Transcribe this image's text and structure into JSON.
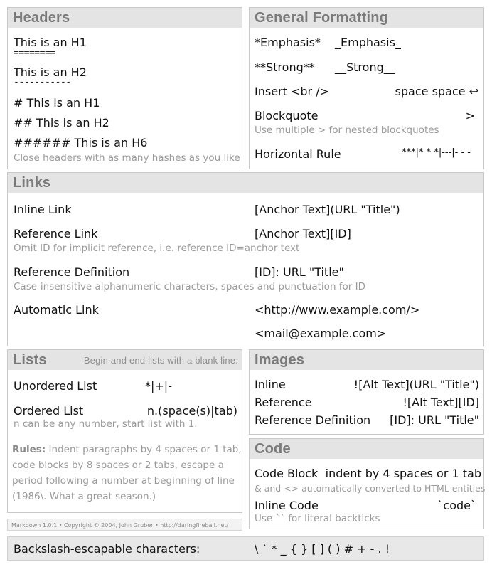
{
  "headers": {
    "title": "Headers",
    "h1_setext": "This is an H1",
    "h1_underline": "========",
    "h2_setext": "This is an H2",
    "h2_underline": "-----------",
    "atx_h1": "# This is an H1",
    "atx_h2": "## This is an H2",
    "atx_h6": "###### This is an H6",
    "note": "Close headers with as many hashes as you like"
  },
  "formatting": {
    "title": "General Formatting",
    "emphasis_a": "*Emphasis*",
    "emphasis_b": "_Emphasis_",
    "strong_a": "**Strong**",
    "strong_b": "__Strong__",
    "insert_br": "Insert <br />",
    "space_space": "space space ↩",
    "blockquote": "Blockquote",
    "blockquote_symbol": ">",
    "blockquote_note": "Use multiple > for nested blockquotes",
    "hr": "Horizontal Rule",
    "hr_syntax": "***|* * *|---|- - -"
  },
  "links": {
    "title": "Links",
    "inline_label": "Inline Link",
    "inline_syntax": "[Anchor Text](URL \"Title\")",
    "reference_label": "Reference Link",
    "reference_syntax": "[Anchor Text][ID]",
    "reference_note": "Omit ID for implicit reference, i.e. reference ID=anchor text",
    "definition_label": "Reference Definition",
    "definition_syntax": "[ID]: URL \"Title\"",
    "definition_note": "Case-insensitive alphanumeric characters, spaces and punctuation for ID",
    "auto_label": "Automatic Link",
    "auto_url": "<http://www.example.com/>",
    "auto_mail": "<mail@example.com>"
  },
  "lists": {
    "title": "Lists",
    "subtitle": "Begin and end lists with a blank line.",
    "unordered_label": "Unordered List",
    "unordered_syntax": "*|+|-",
    "ordered_label": "Ordered List",
    "ordered_syntax": "n.(space(s)|tab)",
    "ordered_note": "n can be any number, start list with 1.",
    "rules_label": "Rules:",
    "rules_line1": " Indent paragraphs by 4 spaces or 1 tab,",
    "rules_line2": "code blocks by 8 spaces or 2 tabs, escape a",
    "rules_line3": "period following a number at beginning of line",
    "rules_line4": "(1986\\. What a great season.)",
    "footer": "Markdown 1.0.1 • Copyright © 2004, John Gruber • http://daringfireball.net/"
  },
  "images": {
    "title": "Images",
    "inline_label": "Inline",
    "inline_syntax": "![Alt Text](URL \"Title\")",
    "reference_label": "Reference",
    "reference_syntax": "![Alt Text][ID]",
    "definition_label": "Reference Definition",
    "definition_syntax": "[ID]: URL \"Title\""
  },
  "code": {
    "title": "Code",
    "block_label": "Code Block",
    "block_syntax": "indent by 4 spaces or 1 tab",
    "block_note": "& and <> automatically converted to HTML entities",
    "inline_label": "Inline Code",
    "inline_syntax": "`code`",
    "inline_note": "Use `` for literal backticks"
  },
  "backslash": {
    "label": "Backslash-escapable characters:",
    "chars": "\\ ` * _ { } [ ] ( ) # + - . !"
  }
}
